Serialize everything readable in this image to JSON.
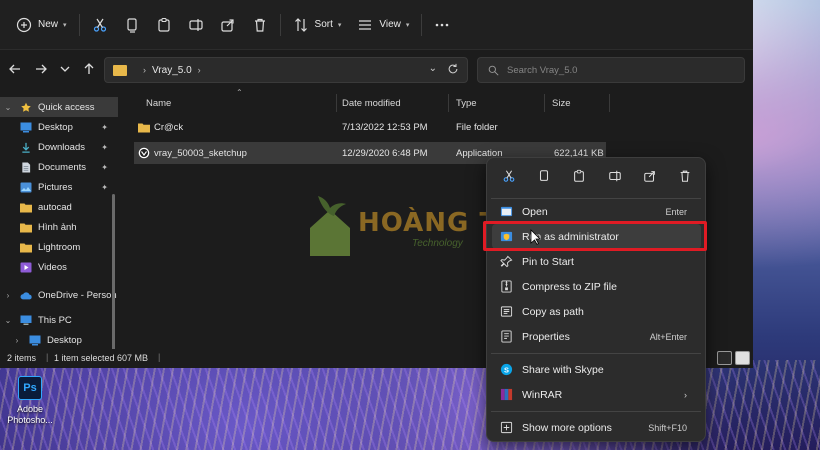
{
  "toolbar": {
    "new_label": "New",
    "sort_label": "Sort",
    "view_label": "View"
  },
  "address": {
    "crumb": "Vray_5.0",
    "search_placeholder": "Search Vray_5.0"
  },
  "sidebar": {
    "items": [
      {
        "label": "Quick access"
      },
      {
        "label": "Desktop"
      },
      {
        "label": "Downloads"
      },
      {
        "label": "Documents"
      },
      {
        "label": "Pictures"
      },
      {
        "label": "autocad"
      },
      {
        "label": "Hình ảnh"
      },
      {
        "label": "Lightroom"
      },
      {
        "label": "Videos"
      },
      {
        "label": "OneDrive - Person"
      },
      {
        "label": "This PC"
      },
      {
        "label": "Desktop"
      }
    ]
  },
  "columns": [
    "Name",
    "Date modified",
    "Type",
    "Size"
  ],
  "files": [
    {
      "name": "Cr@ck",
      "date": "7/13/2022 12:53 PM",
      "type": "File folder",
      "size": ""
    },
    {
      "name": "vray_50003_sketchup",
      "date": "12/29/2020 6:48 PM",
      "type": "Application",
      "size": "622,141 KB"
    }
  ],
  "status": {
    "items": "2 items",
    "selected": "1 item selected  607 MB"
  },
  "context_menu": {
    "items": [
      {
        "label": "Open",
        "shortcut": "Enter"
      },
      {
        "label": "Run as administrator",
        "shortcut": ""
      },
      {
        "label": "Pin to Start",
        "shortcut": ""
      },
      {
        "label": "Compress to ZIP file",
        "shortcut": ""
      },
      {
        "label": "Copy as path",
        "shortcut": ""
      },
      {
        "label": "Properties",
        "shortcut": "Alt+Enter"
      },
      {
        "label": "Share with Skype",
        "shortcut": ""
      },
      {
        "label": "WinRAR",
        "shortcut": ""
      },
      {
        "label": "Show more options",
        "shortcut": "Shift+F10"
      }
    ]
  },
  "watermark": {
    "title": "HOÀNG THÔ",
    "subtitle": "Technology"
  },
  "desktop_icon": {
    "label": "Adobe Photosho..."
  },
  "colors": {
    "highlight": "#e01b24",
    "folder": "#e8b84a",
    "accent": "#4aa3ff"
  }
}
